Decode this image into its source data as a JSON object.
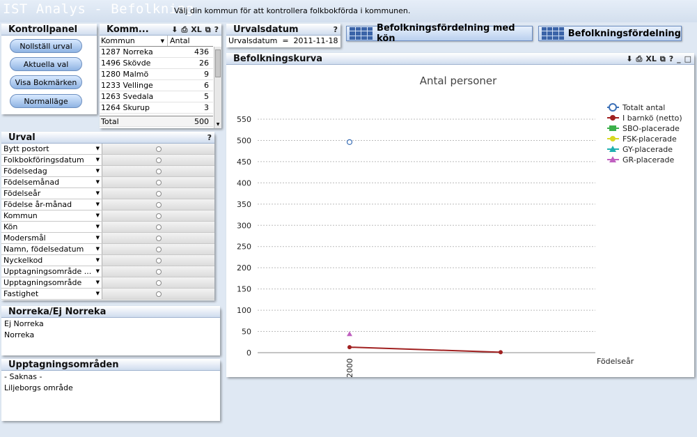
{
  "app": {
    "title": "IST Analys - Befolkning",
    "subtitle": "Välj din kommun för att kontrollera folkbokförda i kommunen."
  },
  "kontrollpanel": {
    "title": "Kontrollpanel",
    "buttons": [
      "Nollställ urval",
      "Aktuella val",
      "Visa Bokmärken",
      "Normalläge"
    ]
  },
  "kommun_table": {
    "title": "Komm...",
    "col_kommun": "Kommun",
    "col_antal": "Antal",
    "rows": [
      {
        "kommun": "1287 Norreka",
        "antal": "436"
      },
      {
        "kommun": "1496 Skövde",
        "antal": "26"
      },
      {
        "kommun": "1280 Malmö",
        "antal": "9"
      },
      {
        "kommun": "1233 Vellinge",
        "antal": "6"
      },
      {
        "kommun": "1263 Svedala",
        "antal": "5"
      },
      {
        "kommun": "1264 Skurup",
        "antal": "3"
      }
    ],
    "total_label": "Total",
    "total_value": "500"
  },
  "urvalsdatum": {
    "title": "Urvalsdatum",
    "text": "Urvalsdatum  =  2011-11-18"
  },
  "buttons": {
    "kon": "Befolkningsfördelning med kön",
    "fordelning": "Befolkningsfördelning"
  },
  "icons": {
    "help": "?",
    "xl": "XL",
    "minimize": "_",
    "maximize": "□"
  },
  "urval": {
    "title": "Urval",
    "fields": [
      "Bytt postort",
      "Folkbokföringsdatum",
      "Födelsedag",
      "Födelsemånad",
      "Födelseår",
      "Födelse år-månad",
      "Kommun",
      "Kön",
      "Modersmål",
      "Namn, födelsedatum",
      "Nyckelkod",
      "Upptagningsområde ...",
      "Upptagningsområde",
      "Fastighet"
    ]
  },
  "norreka": {
    "title": "Norreka/Ej Norreka",
    "items": [
      "Ej Norreka",
      "Norreka"
    ]
  },
  "upptagning": {
    "title": "Upptagningsområden",
    "items": [
      "- Saknas -",
      "Liljeborgs område"
    ]
  },
  "chart_panel": {
    "title": "Befolkningskurva"
  },
  "chart_data": {
    "type": "line",
    "title": "Antal personer",
    "xlabel": "Födelseår",
    "ylabel": "",
    "categories": [
      "2000",
      ""
    ],
    "ylim": [
      0,
      550
    ],
    "yticks": [
      0,
      50,
      100,
      150,
      200,
      250,
      300,
      350,
      400,
      450,
      500,
      550
    ],
    "legend_position": "top-right",
    "series": [
      {
        "name": "Totalt antal",
        "color": "#3b6fb6",
        "marker": "circle-open",
        "values": [
          496,
          null
        ]
      },
      {
        "name": "I barnkö (netto)",
        "color": "#a02020",
        "marker": "circle",
        "values": [
          13,
          1
        ]
      },
      {
        "name": "SBO-placerade",
        "color": "#3cb04a",
        "marker": "square",
        "values": [
          null,
          null
        ]
      },
      {
        "name": "FSK-placerade",
        "color": "#d8d820",
        "marker": "circle",
        "values": [
          null,
          null
        ]
      },
      {
        "name": "GY-placerade",
        "color": "#20b0b0",
        "marker": "triangle",
        "values": [
          null,
          null
        ]
      },
      {
        "name": "GR-placerade",
        "color": "#c060c0",
        "marker": "triangle",
        "values": [
          44,
          null
        ]
      }
    ]
  }
}
